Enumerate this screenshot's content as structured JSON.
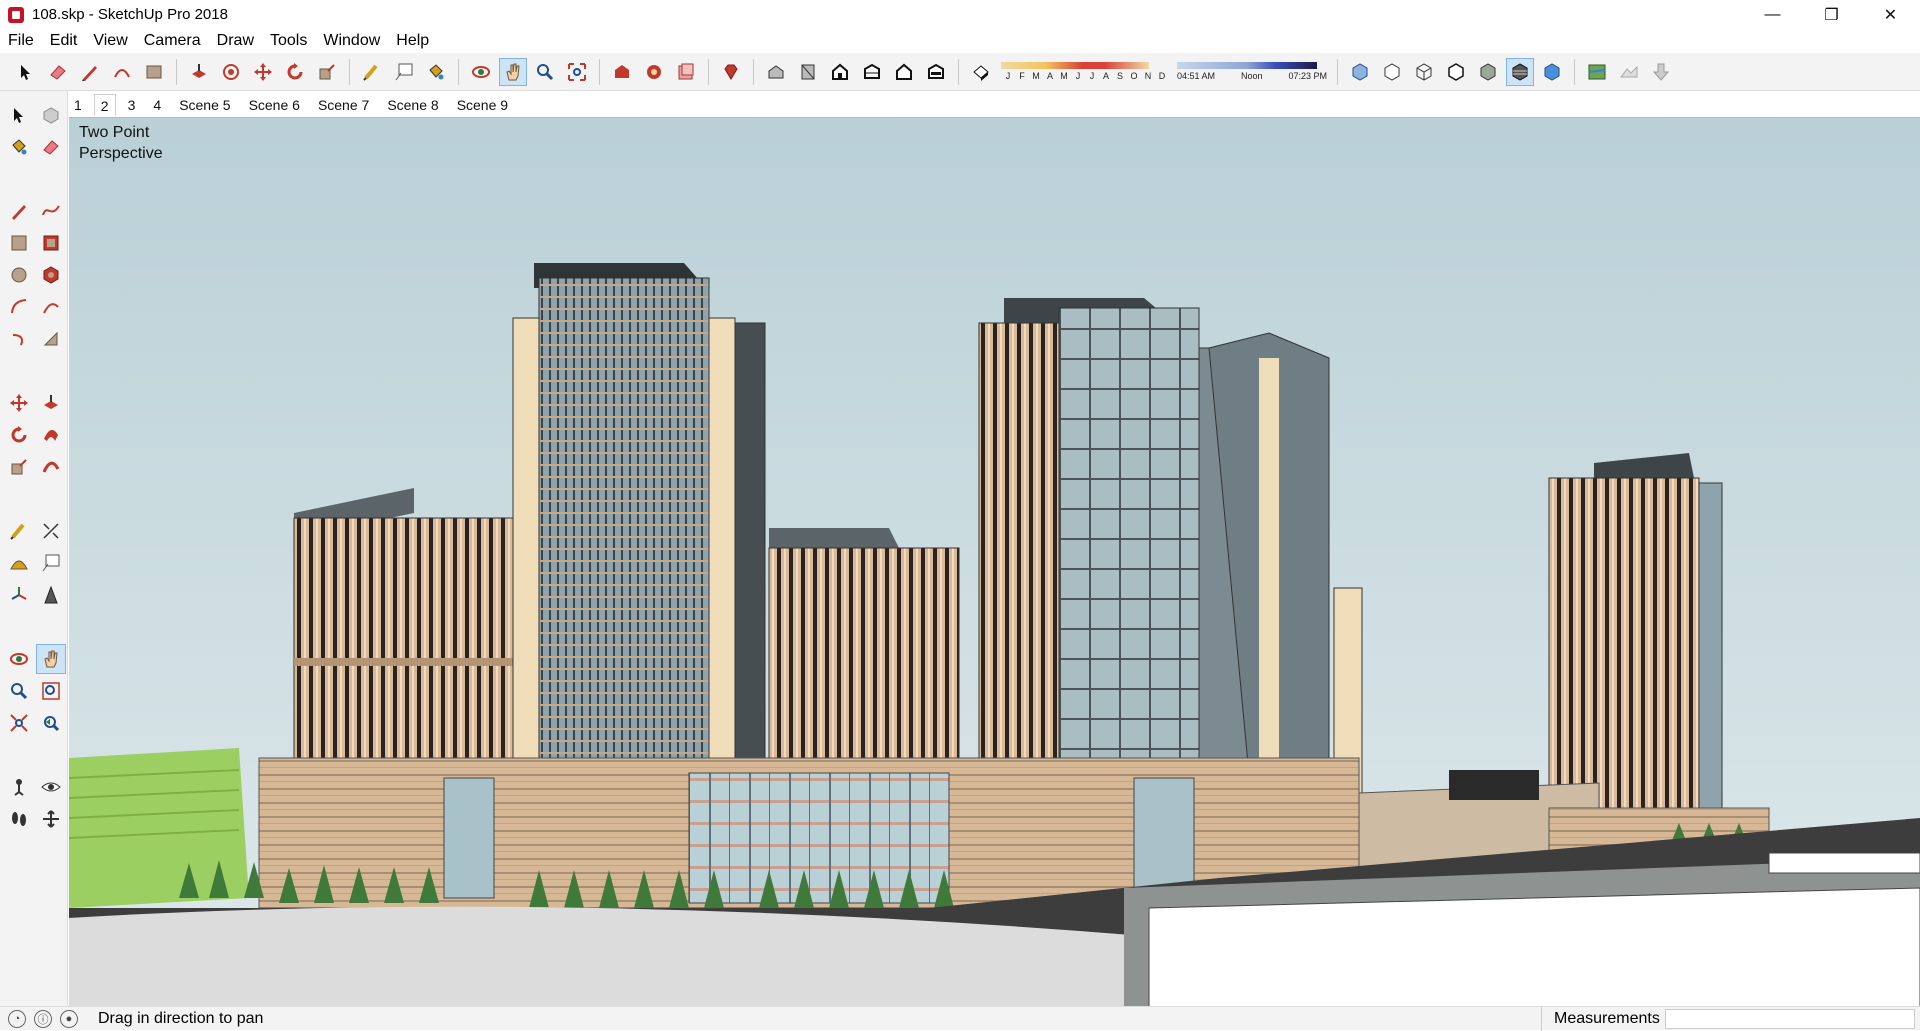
{
  "window": {
    "title": "108.skp - SketchUp Pro 2018",
    "minimize_glyph": "—",
    "restore_glyph": "❐",
    "close_glyph": "✕"
  },
  "menu": [
    "File",
    "Edit",
    "View",
    "Camera",
    "Draw",
    "Tools",
    "Window",
    "Help"
  ],
  "shadows": {
    "months": [
      "J",
      "F",
      "M",
      "A",
      "M",
      "J",
      "J",
      "A",
      "S",
      "O",
      "N",
      "D"
    ],
    "time_start": "04:51 AM",
    "time_mid": "Noon",
    "time_end": "07:23 PM"
  },
  "scenes": {
    "tabs": [
      "1",
      "2",
      "3",
      "4",
      "Scene 5",
      "Scene 6",
      "Scene 7",
      "Scene 8",
      "Scene 9"
    ],
    "active_index": 1
  },
  "viewport": {
    "camera_label": "Two Point\nPerspective",
    "sky_color": "#c9dbe0"
  },
  "status": {
    "hint": "Drag in direction to pan",
    "measurements_label": "Measurements",
    "measurements_value": ""
  },
  "colors": {
    "accent_active": "#cde4f7",
    "facade_beige": "#d9b996",
    "glass_blue": "#8fa3ad",
    "grass": "#9ccf62"
  }
}
